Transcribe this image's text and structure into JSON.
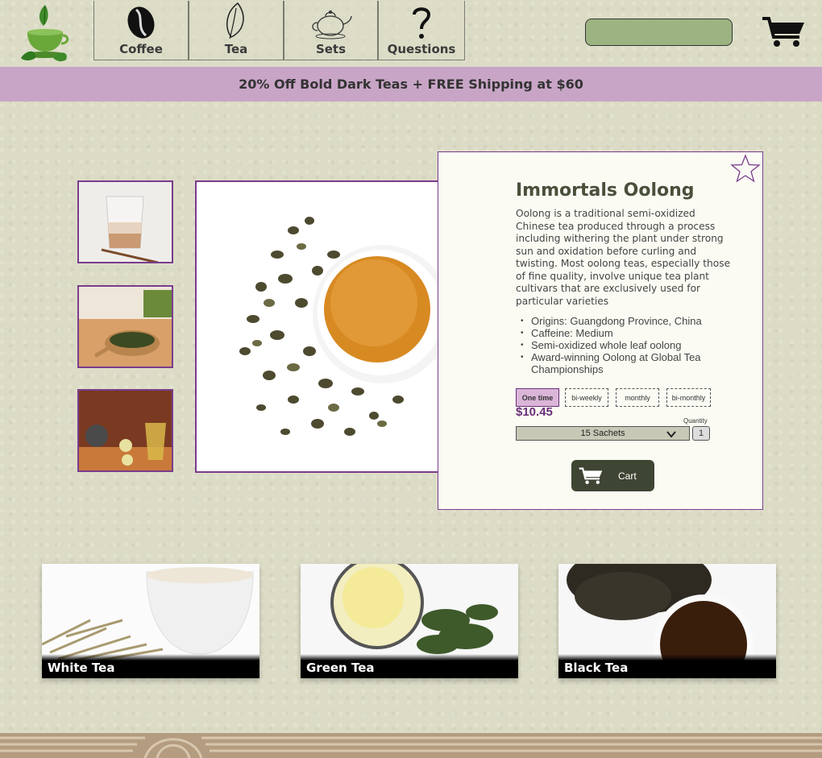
{
  "header": {
    "logo_icon": "teacup-leaf-logo-icon",
    "nav": [
      {
        "label": "Coffee",
        "icon": "coffee-bean-icon"
      },
      {
        "label": "Tea",
        "icon": "tea-leaf-icon"
      },
      {
        "label": "Sets",
        "icon": "teapot-icon"
      },
      {
        "label": "Questions",
        "icon": "question-mark-icon"
      }
    ],
    "search_placeholder": "",
    "cart_icon": "cart-icon"
  },
  "promo": {
    "text": "20% Off Bold Dark Teas + FREE Shipping at $60"
  },
  "gallery": {
    "thumbnails": [
      "latte-glass-thumbnail",
      "loose-leaf-spoon-thumbnail",
      "tea-set-tray-thumbnail"
    ],
    "main_image": "oolong-leaves-cup-image"
  },
  "product": {
    "title": "Immortals Oolong",
    "description": "Oolong is a traditional semi-oxidized Chinese tea produced through a process including withering the plant under strong sun and oxidation before curling and twisting. Most oolong teas, especially those of fine quality, involve unique tea plant cultivars that are exclusively used for particular varieties",
    "bullets": [
      "Origins: Guangdong Province, China",
      "Caffeine: Medium",
      "Semi-oxidized whole leaf oolong",
      "Award-winning Oolong at Global Tea Championships"
    ],
    "frequency": [
      "One time",
      "bi-weekly",
      "monthly",
      "bi-monthly"
    ],
    "selected_frequency": "One time",
    "price": "$10.45",
    "size": "15 Sachets",
    "quantity_label": "Quantity",
    "quantity": "1",
    "cart_label": "Cart",
    "favorite_icon": "star-icon"
  },
  "categories": [
    {
      "label": "White Tea"
    },
    {
      "label": "Green Tea"
    },
    {
      "label": "Black Tea"
    }
  ],
  "colors": {
    "accent": "#7a3c8e",
    "promo_bg": "#c8a5c6",
    "search_bg": "#9cb482",
    "cart_button": "#3f4533",
    "price": "#6a2f78"
  }
}
